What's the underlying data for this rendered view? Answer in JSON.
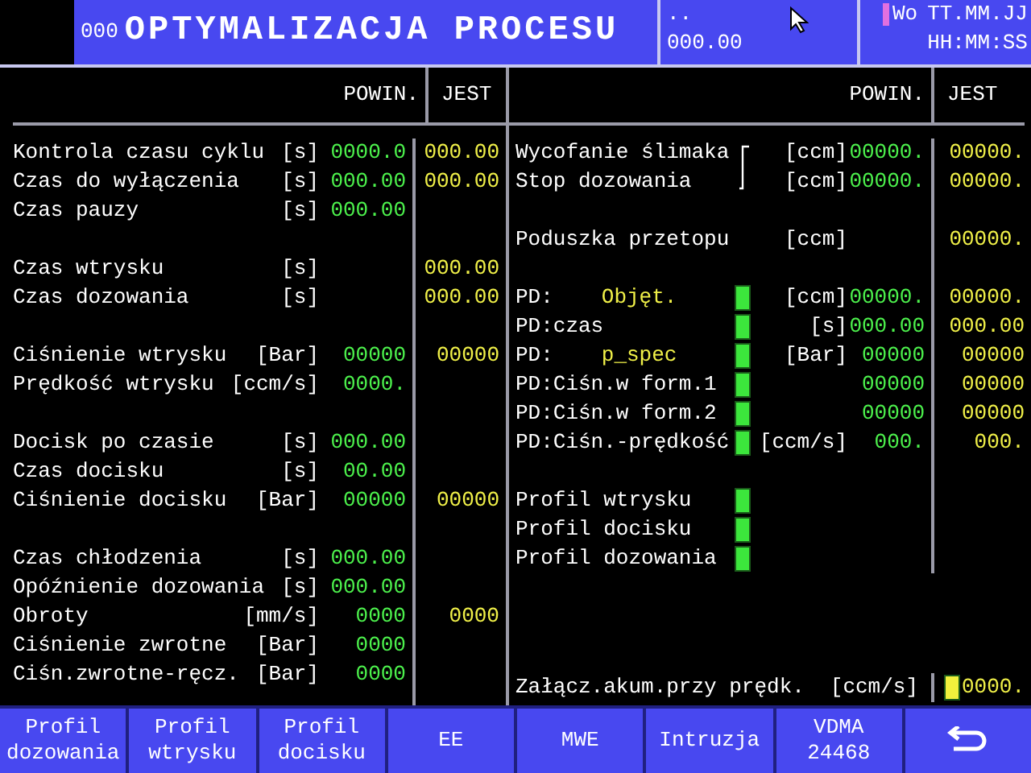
{
  "header": {
    "code": "000",
    "title": "OPTYMALIZACJA PROCESU",
    "status_top": "..",
    "status_value": "000.00",
    "mode": "Wo",
    "date": "TT.MM.JJ",
    "time": "HH:MM:SS"
  },
  "columns": {
    "left": {
      "set": "POWIN.",
      "actual": "JEST"
    },
    "right": {
      "set": "POWIN.",
      "actual": "JEST"
    }
  },
  "left_sections": [
    {
      "rows": [
        {
          "label": "Kontrola czasu cyklu",
          "unit": "[s]",
          "set": "0000.0",
          "actual": "000.00"
        },
        {
          "label": "Czas do wyłączenia",
          "unit": "[s]",
          "set": "000.00",
          "actual": "000.00"
        },
        {
          "label": "Czas pauzy",
          "unit": "[s]",
          "set": "000.00"
        }
      ]
    },
    {
      "rows": [
        {
          "label": "Czas wtrysku",
          "unit": "[s]",
          "actual": "000.00"
        },
        {
          "label": "Czas dozowania",
          "unit": "[s]",
          "actual": "000.00"
        }
      ]
    },
    {
      "rows": [
        {
          "label": "Ciśnienie wtrysku",
          "unit": "[Bar]",
          "set": "00000",
          "actual": "00000"
        },
        {
          "label": "Prędkość wtrysku",
          "unit": "[ccm/s]",
          "set": "0000."
        }
      ]
    },
    {
      "rows": [
        {
          "label": "Docisk po czasie",
          "unit": "[s]",
          "set": "000.00"
        },
        {
          "label": "Czas docisku",
          "unit": "[s]",
          "set": "00.00"
        },
        {
          "label": "Ciśnienie docisku",
          "unit": "[Bar]",
          "set": "00000",
          "actual": "00000"
        }
      ]
    },
    {
      "rows": [
        {
          "label": "Czas chłodzenia",
          "unit": "[s]",
          "set": "000.00"
        },
        {
          "label": "Opóźnienie dozowania",
          "unit": "[s]",
          "set": "000.00"
        },
        {
          "label": "Obroty",
          "unit": "[mm/s]",
          "set": "0000",
          "actual": "0000"
        },
        {
          "label": "Ciśnienie zwrotne",
          "unit": "[Bar]",
          "set": "0000"
        },
        {
          "label": "Ciśn.zwrotne-ręcz.",
          "unit": "[Bar]",
          "set": "0000"
        }
      ]
    }
  ],
  "right_sections": [
    {
      "linked": true,
      "rows": [
        {
          "kind": "value",
          "label": "Wycofanie ślimaka",
          "unit": "[ccm]",
          "set": "00000.",
          "actual": "00000."
        },
        {
          "kind": "value",
          "label": "Stop dozowania",
          "unit": "[ccm]",
          "set": "00000.",
          "actual": "00000."
        }
      ]
    },
    {
      "linked": false,
      "rows": [
        {
          "kind": "value",
          "label": "Poduszka przetopu",
          "unit": "[ccm]",
          "actual": "00000."
        }
      ]
    },
    {
      "linked": false,
      "rows": [
        {
          "kind": "value",
          "label": "PD:",
          "parameter": "Objęt.",
          "indicator": {
            "color": "#3ce63c"
          },
          "unit": "[ccm]",
          "set": "00000.",
          "actual": "00000."
        },
        {
          "kind": "value",
          "label": "PD:czas",
          "indicator": {
            "color": "#3ce63c"
          },
          "unit": "[s]",
          "set": "000.00",
          "actual": "000.00"
        },
        {
          "kind": "value",
          "label": "PD:",
          "parameter": "p_spec",
          "indicator": {
            "color": "#3ce63c"
          },
          "unit": "[Bar]",
          "set": "00000",
          "actual": "00000"
        },
        {
          "kind": "value",
          "label": "PD:Ciśn.w form.1",
          "indicator": {
            "color": "#3ce63c"
          },
          "set": "00000",
          "actual": "00000"
        },
        {
          "kind": "value",
          "label": "PD:Ciśn.w form.2",
          "indicator": {
            "color": "#3ce63c"
          },
          "set": "00000",
          "actual": "00000"
        },
        {
          "kind": "value",
          "label": "PD:Ciśn.-prędkość",
          "indicator": {
            "color": "#3ce63c"
          },
          "unit": "[ccm/s]",
          "set": "000.",
          "actual": "000."
        }
      ]
    },
    {
      "linked": false,
      "rows": [
        {
          "kind": "value",
          "label": "Profil wtrysku",
          "indicator": {
            "color": "#3ce63c"
          }
        },
        {
          "kind": "value",
          "label": "Profil docisku",
          "indicator": {
            "color": "#3ce63c"
          }
        },
        {
          "kind": "value",
          "label": "Profil dozowania",
          "indicator": {
            "color": "#3ce63c"
          }
        }
      ]
    },
    {
      "linked": false,
      "rows": [
        {
          "kind": "wide",
          "label": "Załącz.akum.przy prędk.",
          "unit": "[ccm/s]",
          "indicator": {
            "color": "#f0f03c"
          },
          "actual": "0000."
        }
      ]
    }
  ],
  "buttons": [
    {
      "kind": "text",
      "lines": [
        "Profil",
        "dozowania"
      ]
    },
    {
      "kind": "text",
      "lines": [
        "Profil",
        "wtrysku"
      ]
    },
    {
      "kind": "text",
      "lines": [
        "Profil",
        "docisku"
      ]
    },
    {
      "kind": "text",
      "lines": [
        "EE"
      ]
    },
    {
      "kind": "text",
      "lines": [
        "MWE"
      ]
    },
    {
      "kind": "text",
      "lines": [
        "Intruzja"
      ]
    },
    {
      "kind": "text",
      "lines": [
        "VDMA",
        "24468"
      ]
    },
    {
      "kind": "return"
    }
  ]
}
